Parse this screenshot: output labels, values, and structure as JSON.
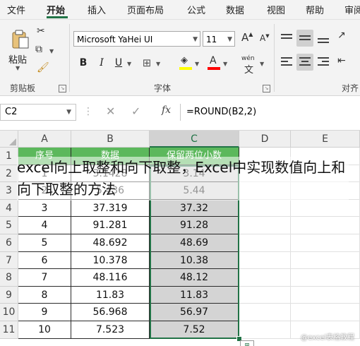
{
  "menu": {
    "tabs": [
      "文件",
      "开始",
      "插入",
      "页面布局",
      "公式",
      "数据",
      "视图",
      "帮助",
      "审阅"
    ],
    "active_tab": "开始"
  },
  "ribbon": {
    "clipboard": {
      "paste_label": "粘贴",
      "group_label": "剪贴板"
    },
    "font": {
      "font_name": "Microsoft YaHei UI",
      "font_size": "11",
      "bold": "B",
      "italic": "I",
      "underline": "U",
      "increase_font": "A",
      "decrease_font": "A",
      "font_color": "A",
      "phonetic": "wén",
      "group_label": "字体"
    },
    "alignment": {
      "group_label": "对齐"
    }
  },
  "formula_bar": {
    "name_box": "C2",
    "cancel": "✕",
    "enter": "✓",
    "fx": "fx",
    "formula": "=ROUND(B2,2)"
  },
  "sheet": {
    "columns": [
      "A",
      "B",
      "C",
      "D",
      "E"
    ],
    "rows": [
      "1",
      "2",
      "3",
      "4",
      "5",
      "6",
      "7",
      "8",
      "9",
      "10",
      "11"
    ],
    "selected_column": "C",
    "selected_cell": "C2",
    "header_row": [
      "序号",
      "数据",
      "保留两位小数"
    ],
    "data_rows": [
      [
        "1",
        "3.1428",
        "3.14"
      ],
      [
        "2",
        "5.436",
        "5.44"
      ],
      [
        "3",
        "37.319",
        "37.32"
      ],
      [
        "4",
        "91.281",
        "91.28"
      ],
      [
        "5",
        "48.692",
        "48.69"
      ],
      [
        "6",
        "10.378",
        "10.38"
      ],
      [
        "7",
        "48.116",
        "48.12"
      ],
      [
        "8",
        "11.83",
        "11.83"
      ],
      [
        "9",
        "56.968",
        "56.97"
      ],
      [
        "10",
        "7.523",
        "7.52"
      ]
    ]
  },
  "overlay_caption": "excel向上取整和向下取整，Excel中实现数值向上和向下取整的方法",
  "watermark": "@excel表格教程",
  "colors": {
    "accent": "#217346",
    "header_fill": "#5cb85c",
    "selection_fill": "#d4d4d4"
  }
}
